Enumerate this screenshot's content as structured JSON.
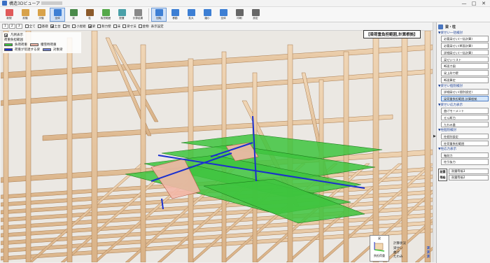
{
  "window": {
    "title": "構造3Dビューア",
    "minimize": "—",
    "maximize": "□",
    "close": "✕"
  },
  "toolbar": [
    {
      "label": "新規",
      "icon": "new-doc-icon",
      "color": "#e05a5a"
    },
    {
      "label": "前階",
      "icon": "up-floor-icon",
      "color": "#d8a24a"
    },
    {
      "label": "次階",
      "icon": "down-floor-icon",
      "color": "#d8a24a"
    },
    {
      "label": "全体",
      "icon": "whole-icon",
      "color": "#3d7fd4",
      "active": true
    },
    {
      "label": "梁",
      "icon": "beam-icon",
      "color": "#4a8a4a"
    },
    {
      "label": "柱",
      "icon": "column-icon",
      "color": "#8b5a2b"
    },
    {
      "label": "負担範囲",
      "icon": "load-range-icon",
      "color": "#55a84a"
    },
    {
      "label": "配置",
      "icon": "layout-icon",
      "color": "#4aa0a8"
    },
    {
      "label": "計算結果",
      "icon": "calc-result-icon",
      "color": "#888888"
    },
    {
      "label": "回転",
      "icon": "rotate-icon",
      "color": "#3d7fd4",
      "active": true
    },
    {
      "label": "移動",
      "icon": "pan-icon",
      "color": "#3d7fd4"
    },
    {
      "label": "拡大",
      "icon": "zoom-in-icon",
      "color": "#3d7fd4"
    },
    {
      "label": "縮小",
      "icon": "zoom-out-icon",
      "color": "#3d7fd4"
    },
    {
      "label": "全体",
      "icon": "fit-icon",
      "color": "#3d7fd4"
    },
    {
      "label": "印刷",
      "icon": "print-icon",
      "color": "#666666"
    },
    {
      "label": "設定",
      "icon": "settings-icon",
      "color": "#666666"
    }
  ],
  "subbar": {
    "floors": [
      "1",
      "2",
      "3"
    ],
    "options": [
      {
        "label": "全て",
        "checked": false
      },
      {
        "label": "基礎",
        "checked": false
      },
      {
        "label": "土台",
        "checked": true
      },
      {
        "label": "柱",
        "checked": false
      },
      {
        "label": "小屋組",
        "checked": false
      },
      {
        "label": "梁",
        "checked": true
      },
      {
        "label": "耐力壁",
        "checked": false
      },
      {
        "label": "床",
        "checked": false
      },
      {
        "label": "梁寸法",
        "checked": false
      },
      {
        "label": "金物",
        "checked": false
      }
    ],
    "extra": "表示設定"
  },
  "legend": {
    "header": "凡例表示",
    "title": "荷重負担範囲",
    "items": [
      {
        "label": "負荷荷重",
        "color": "#3ec43e"
      },
      {
        "label": "積雪時荷重",
        "color": "#f3b8a8"
      },
      {
        "label": "荷重が伝達する梁",
        "color": "#1a2fcf"
      },
      {
        "label": "対象梁",
        "color": "#7080d8"
      }
    ]
  },
  "view_title": "【梁荷重負担範囲,計算根拠】",
  "axis_box": {
    "label": "梁",
    "caption": "負担荷重"
  },
  "result": {
    "title": "計算状況",
    "rows": [
      {
        "label": "梁せい",
        "value": "済"
      },
      {
        "label": "曲げ",
        "value": "済"
      },
      {
        "label": "たわみ",
        "value": "済"
      }
    ]
  },
  "panel": {
    "header": "梁・柱",
    "sections": [
      {
        "title": "▼梁せい一括検討",
        "buttons": [
          {
            "label": "必要梁せい(一括計算)",
            "active": false
          },
          {
            "label": "必要梁せい(断面計算)",
            "active": false
          },
          {
            "label": "詳細梁せい(一括計算)",
            "active": false
          },
          {
            "label": "梁せいリスト",
            "active": false
          },
          {
            "label": "断面力図",
            "active": false
          },
          {
            "label": "梁上耐力壁",
            "active": false
          },
          {
            "label": "断面算定",
            "active": false
          }
        ]
      },
      {
        "title": "▼梁せい個別検討",
        "buttons": [
          {
            "label": "詳細梁せい(個別設定)",
            "active": false
          },
          {
            "label": "梁荷重負担範囲,計算根拠",
            "active": true
          }
        ]
      },
      {
        "title": "▼梁せい応力表示",
        "buttons": [
          {
            "label": "曲げモーメント",
            "active": false
          },
          {
            "label": "せん断力",
            "active": false
          },
          {
            "label": "たわみ量",
            "active": false
          }
        ]
      },
      {
        "title": "▼柱個別検討",
        "buttons": [
          {
            "label": "柱個別設定",
            "active": false
          },
          {
            "label": "柱荷重負担範囲",
            "active": false
          }
        ]
      },
      {
        "title": "▼柱応力表示",
        "buttons": [
          {
            "label": "軸耐力",
            "active": false
          },
          {
            "label": "柱引抜力",
            "active": false
          }
        ]
      }
    ],
    "grade": {
      "icon_label": "耐震等級",
      "buttons": [
        "耐震等級3",
        "耐震等級2"
      ]
    }
  },
  "colors": {
    "timber": "#e8c8a2",
    "timber_edge": "#a77a4e",
    "load_green": "#3ec43e",
    "load_salmon": "#f3b8a8",
    "beam_blue": "#1a2fcf"
  }
}
